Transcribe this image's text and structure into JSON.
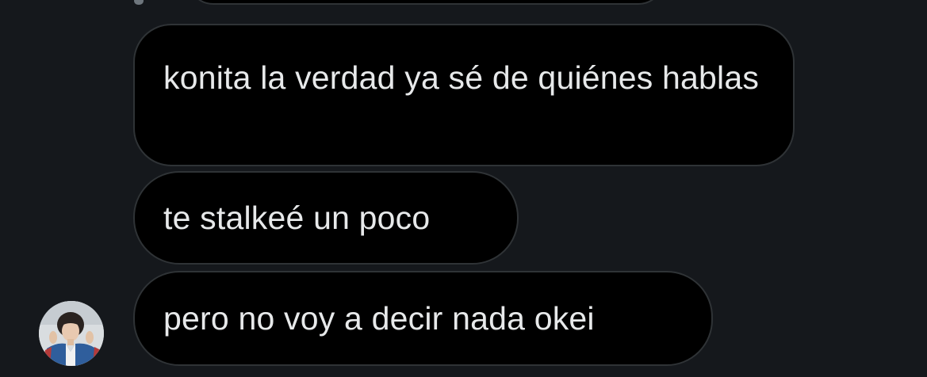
{
  "conversation": {
    "messages": [
      {
        "text": "konita la verdad ya sé de quiénes hablas"
      },
      {
        "text": "te stalkeé un poco"
      },
      {
        "text": "pero no voy a decir nada okei"
      }
    ]
  },
  "colors": {
    "background": "#15181c",
    "bubble_fill": "#000000",
    "bubble_border": "#2f3336",
    "text": "#e7e9ea"
  },
  "icons": {
    "avatar": "user-avatar-photo"
  }
}
